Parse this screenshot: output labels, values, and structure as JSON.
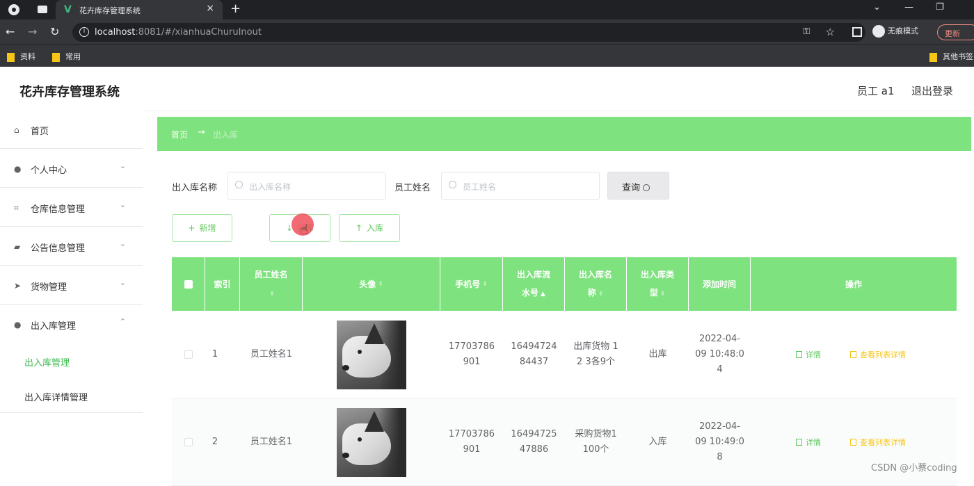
{
  "browser": {
    "tab_title": "花卉库存管理系统",
    "url_host": "localhost",
    "url_path": ":8081/#/xianhuaChuruInout",
    "incognito_label": "无痕模式",
    "update_label": "更新",
    "bookmarks": [
      "资料",
      "常用"
    ],
    "other_bookmarks": "其他书签"
  },
  "app": {
    "title": "花卉库存管理系统",
    "user": "员工 a1",
    "logout": "退出登录"
  },
  "sidebar": {
    "items": [
      {
        "label": "首页",
        "icon": "home-icon"
      },
      {
        "label": "个人中心",
        "icon": "user-icon"
      },
      {
        "label": "仓库信息管理",
        "icon": "crop-icon"
      },
      {
        "label": "公告信息管理",
        "icon": "suitcase-icon"
      },
      {
        "label": "货物管理",
        "icon": "send-icon"
      },
      {
        "label": "出入库管理",
        "icon": "user-icon"
      }
    ],
    "sub_items": [
      "出入库管理",
      "出入库详情管理"
    ]
  },
  "breadcrumb": {
    "home": "首页",
    "separator": "→",
    "current": "出入库"
  },
  "search": {
    "name_label": "出入库名称",
    "name_placeholder": "出入库名称",
    "staff_label": "员工姓名",
    "staff_placeholder": "员工姓名",
    "query_label": "查询"
  },
  "actions": {
    "add": "新增",
    "out": "出库",
    "in": "入库"
  },
  "table": {
    "headers": [
      "索引",
      "员工姓名",
      "头像",
      "手机号",
      "出入库流水号",
      "出入库名称",
      "出入库类型",
      "添加时间",
      "操作"
    ],
    "rows": [
      {
        "index": "1",
        "staff": "员工姓名1",
        "phone_a": "17703786",
        "phone_b": "901",
        "serial_a": "16494724",
        "serial_b": "84437",
        "name_a": "出库货物 1",
        "name_b": "2 3各9个",
        "type": "出库",
        "time_a": "2022-04-",
        "time_b": "09 10:48:0",
        "time_c": "4",
        "detail": "详情",
        "list_detail": "查看列表详情"
      },
      {
        "index": "2",
        "staff": "员工姓名1",
        "phone_a": "17703786",
        "phone_b": "901",
        "serial_a": "16494725",
        "serial_b": "47886",
        "name_a": "采购货物1",
        "name_b": "100个",
        "type": "入库",
        "time_a": "2022-04-",
        "time_b": "09 10:49:0",
        "time_c": "8",
        "detail": "详情",
        "list_detail": "查看列表详情"
      }
    ]
  },
  "watermark": "CSDN @小蔡coding",
  "colors": {
    "accent": "#7ee27e",
    "link_green": "#5ec85e",
    "link_yellow": "#f5c518"
  }
}
